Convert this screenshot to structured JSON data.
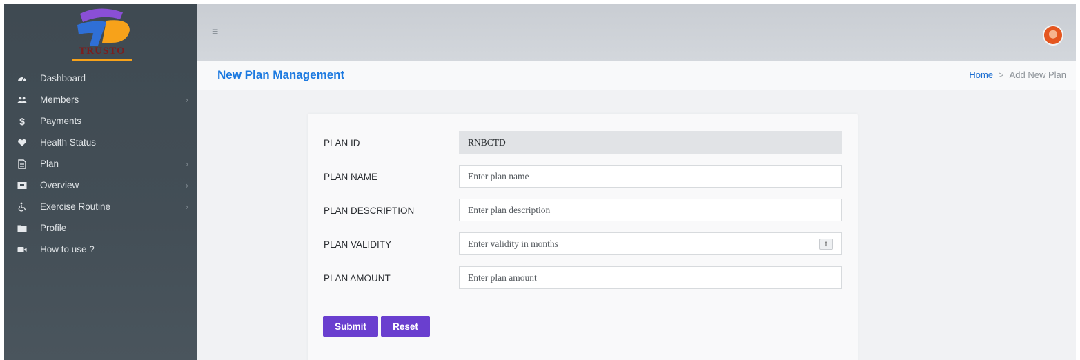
{
  "brand": {
    "logo_text": "TRUSTO"
  },
  "sidebar": {
    "items": [
      {
        "label": "Dashboard",
        "icon": "tachometer-icon",
        "has_submenu": false
      },
      {
        "label": "Members",
        "icon": "users-icon",
        "has_submenu": true
      },
      {
        "label": "Payments",
        "icon": "dollar-icon",
        "has_submenu": false
      },
      {
        "label": "Health Status",
        "icon": "heart-icon",
        "has_submenu": false
      },
      {
        "label": "Plan",
        "icon": "file-icon",
        "has_submenu": true
      },
      {
        "label": "Overview",
        "icon": "inbox-icon",
        "has_submenu": true
      },
      {
        "label": "Exercise Routine",
        "icon": "wheelchair-icon",
        "has_submenu": true
      },
      {
        "label": "Profile",
        "icon": "folder-icon",
        "has_submenu": false
      },
      {
        "label": "How to use ?",
        "icon": "video-camera-icon",
        "has_submenu": false
      }
    ]
  },
  "header": {
    "menu_icon": "hamburger-icon",
    "avatar_icon": "user-avatar-icon"
  },
  "page": {
    "title": "New Plan Management",
    "breadcrumb": {
      "home": "Home",
      "separator": ">",
      "current": "Add New Plan"
    }
  },
  "form": {
    "plan_id": {
      "label": "PLAN ID",
      "value": "RNBCTD"
    },
    "plan_name": {
      "label": "PLAN NAME",
      "placeholder": "Enter plan name"
    },
    "plan_description": {
      "label": "PLAN DESCRIPTION",
      "placeholder": "Enter plan description"
    },
    "plan_validity": {
      "label": "PLAN VALIDITY",
      "placeholder": "Enter validity in months"
    },
    "plan_amount": {
      "label": "PLAN AMOUNT",
      "placeholder": "Enter plan amount"
    },
    "submit_label": "Submit",
    "reset_label": "Reset"
  },
  "colors": {
    "sidebar_bg": "#434e56",
    "accent_title": "#1d7ae0",
    "button_bg": "#6a3fcf",
    "logo_orange": "#f7a21a",
    "logo_blue": "#2f6fd6",
    "logo_purple": "#8a4fd6"
  }
}
